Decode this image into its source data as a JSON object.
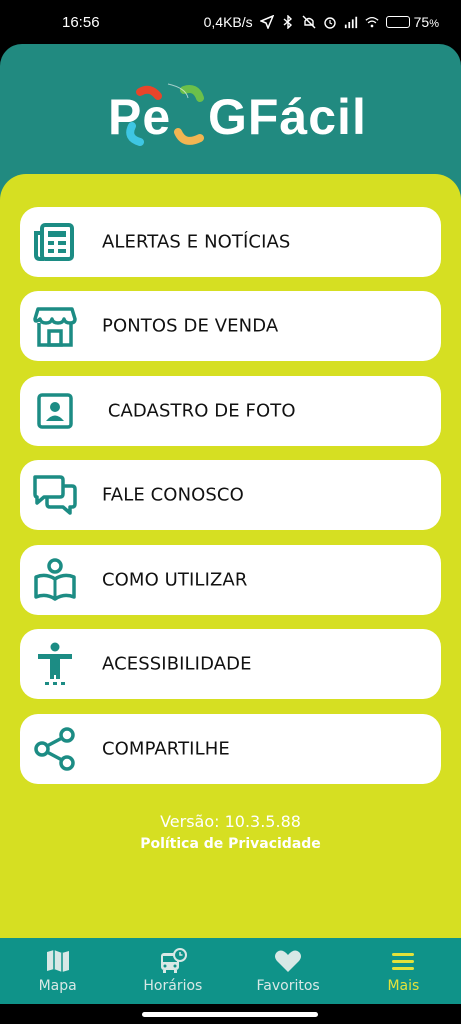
{
  "status": {
    "time": "16:56",
    "network_speed": "0,4KB/s",
    "battery_percent": "75",
    "battery_suffix": "%",
    "icons": [
      "location-arrow-icon",
      "bluetooth-icon",
      "mute-icon",
      "alarm-icon",
      "signal-icon",
      "wifi-icon",
      "battery-icon"
    ]
  },
  "brand": {
    "logo_text_left": "Pe",
    "logo_text_right": "GFácil",
    "colors": {
      "header": "#218a80",
      "panel": "#d6df22",
      "accent": "#1c8c84",
      "nav": "#0f9389",
      "nav_active": "#e3e23a"
    }
  },
  "menu": {
    "items": [
      {
        "label": "ALERTAS E NOTÍCIAS",
        "icon": "newspaper-icon"
      },
      {
        "label": "PONTOS DE VENDA",
        "icon": "store-icon"
      },
      {
        "label": " CADASTRO DE FOTO",
        "icon": "portrait-icon"
      },
      {
        "label": "FALE CONOSCO",
        "icon": "chat-icon"
      },
      {
        "label": "COMO UTILIZAR",
        "icon": "reading-icon"
      },
      {
        "label": "ACESSIBILIDADE",
        "icon": "accessibility-icon"
      },
      {
        "label": "COMPARTILHE",
        "icon": "share-icon"
      }
    ]
  },
  "footer": {
    "version": "Versão: 10.3.5.88",
    "privacy": "Política de Privacidade"
  },
  "nav": {
    "items": [
      {
        "label": "Mapa",
        "icon": "map-icon",
        "active": false
      },
      {
        "label": "Horários",
        "icon": "bus-clock-icon",
        "active": false
      },
      {
        "label": "Favoritos",
        "icon": "heart-icon",
        "active": false
      },
      {
        "label": "Mais",
        "icon": "hamburger-menu-icon",
        "active": true
      }
    ]
  }
}
